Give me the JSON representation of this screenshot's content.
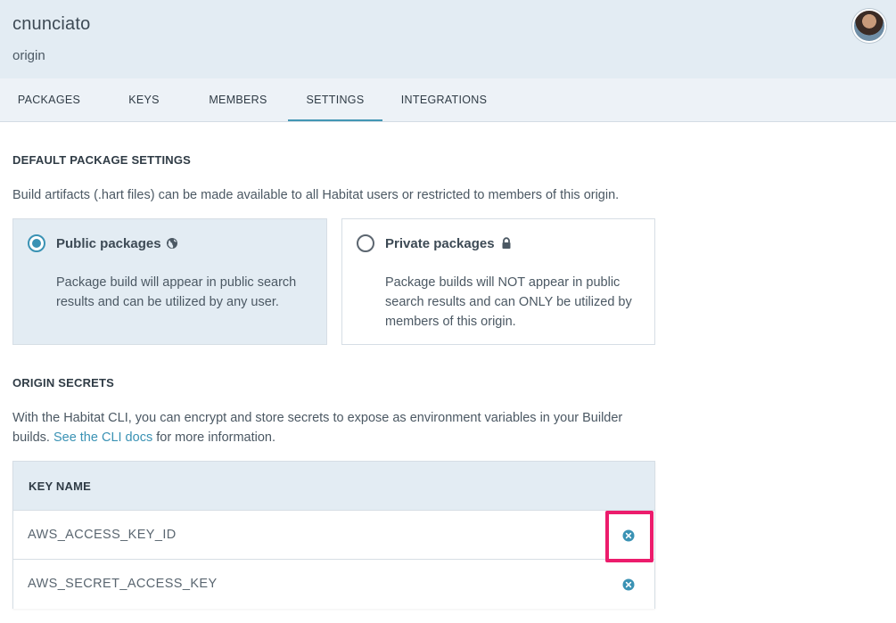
{
  "header": {
    "origin_name": "cnunciato",
    "origin_label": "origin",
    "avatar_icon": "user-avatar"
  },
  "tabs": [
    {
      "label": "PACKAGES",
      "active": false
    },
    {
      "label": "KEYS",
      "active": false
    },
    {
      "label": "MEMBERS",
      "active": false
    },
    {
      "label": "SETTINGS",
      "active": true
    },
    {
      "label": "INTEGRATIONS",
      "active": false
    }
  ],
  "package_settings": {
    "title": "DEFAULT PACKAGE SETTINGS",
    "description": "Build artifacts (.hart files) can be made available to all Habitat users or restricted to members of this origin.",
    "options": [
      {
        "label": "Public packages",
        "icon": "globe-icon",
        "selected": true,
        "description": "Package build will appear in public search results and can be utilized by any user."
      },
      {
        "label": "Private packages",
        "icon": "lock-icon",
        "selected": false,
        "description": "Package builds will NOT appear in public search results and can ONLY be utilized by members of this origin."
      }
    ]
  },
  "origin_secrets": {
    "title": "ORIGIN SECRETS",
    "description_before": "With the Habitat CLI, you can encrypt and store secrets to expose as environment variables in your Builder builds.",
    "link_text": "See the CLI docs",
    "description_after": "for more information.",
    "table": {
      "header": "KEY NAME",
      "rows": [
        {
          "name": "AWS_ACCESS_KEY_ID",
          "action_icon": "remove-icon"
        },
        {
          "name": "AWS_SECRET_ACCESS_KEY",
          "action_icon": "remove-icon"
        }
      ]
    }
  },
  "colors": {
    "accent": "#3a92b4",
    "header_bg": "#e3ecf3",
    "highlight": "#ec1c6c"
  }
}
